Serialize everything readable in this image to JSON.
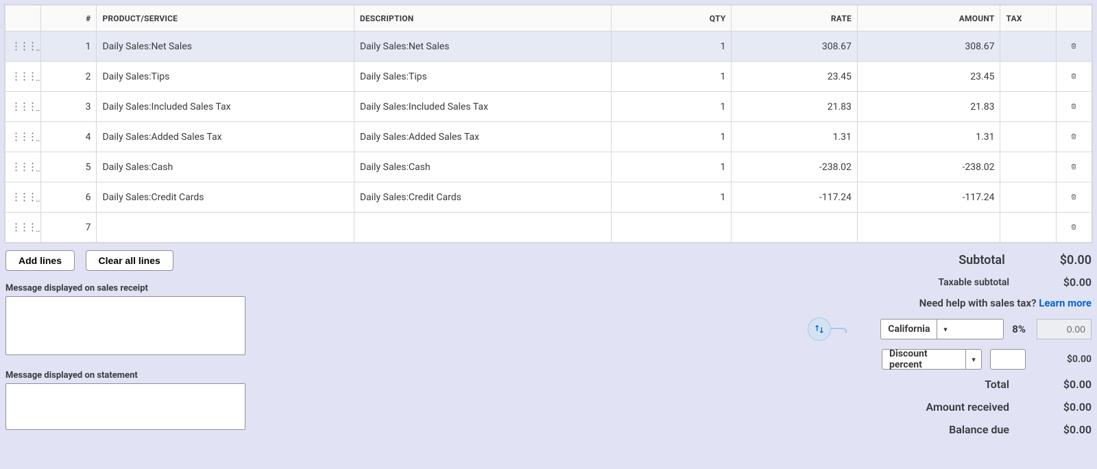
{
  "columns": {
    "idx": "#",
    "product": "PRODUCT/SERVICE",
    "description": "DESCRIPTION",
    "qty": "QTY",
    "rate": "RATE",
    "amount": "AMOUNT",
    "tax": "TAX"
  },
  "rows": [
    {
      "n": "1",
      "product": "Daily Sales:Net Sales",
      "desc": "Daily Sales:Net Sales",
      "qty": "1",
      "rate": "308.67",
      "amount": "308.67",
      "highlight": true
    },
    {
      "n": "2",
      "product": "Daily Sales:Tips",
      "desc": "Daily Sales:Tips",
      "qty": "1",
      "rate": "23.45",
      "amount": "23.45"
    },
    {
      "n": "3",
      "product": "Daily Sales:Included Sales Tax",
      "desc": "Daily Sales:Included Sales Tax",
      "qty": "1",
      "rate": "21.83",
      "amount": "21.83"
    },
    {
      "n": "4",
      "product": "Daily Sales:Added Sales Tax",
      "desc": "Daily Sales:Added Sales Tax",
      "qty": "1",
      "rate": "1.31",
      "amount": "1.31"
    },
    {
      "n": "5",
      "product": "Daily Sales:Cash",
      "desc": "Daily Sales:Cash",
      "qty": "1",
      "rate": "-238.02",
      "amount": "-238.02"
    },
    {
      "n": "6",
      "product": "Daily Sales:Credit Cards",
      "desc": "Daily Sales:Credit Cards",
      "qty": "1",
      "rate": "-117.24",
      "amount": "-117.24"
    },
    {
      "n": "7",
      "product": "",
      "desc": "",
      "qty": "",
      "rate": "",
      "amount": ""
    }
  ],
  "buttons": {
    "add_lines": "Add lines",
    "clear_all": "Clear all lines"
  },
  "messages": {
    "receipt_label": "Message displayed on sales receipt",
    "receipt_value": "",
    "statement_label": "Message displayed on statement",
    "statement_value": ""
  },
  "tax": {
    "taxable_subtotal_label": "Taxable subtotal",
    "taxable_subtotal_value": "$0.00",
    "help_text": "Need help with sales tax?",
    "learn_more": "Learn more",
    "region": "California",
    "rate": "8%",
    "amount": "0.00"
  },
  "discount": {
    "type": "Discount percent",
    "input": "",
    "amount": "$0.00"
  },
  "totals": {
    "subtotal_label": "Subtotal",
    "subtotal_value": "$0.00",
    "total_label": "Total",
    "total_value": "$0.00",
    "received_label": "Amount received",
    "received_value": "$0.00",
    "balance_label": "Balance due",
    "balance_value": "$0.00"
  }
}
